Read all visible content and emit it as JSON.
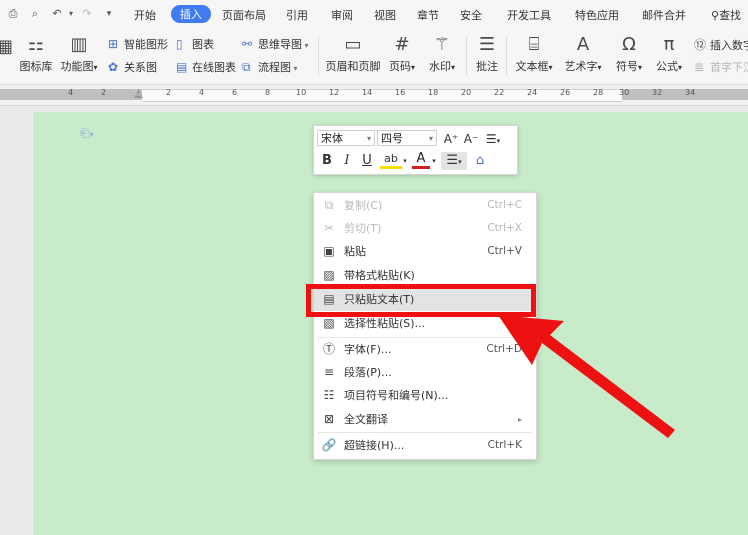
{
  "quick_access": [
    "print-icon",
    "preview-icon",
    "undo-icon",
    "undo-dropdown-icon",
    "redo-icon",
    "customize-icon"
  ],
  "tabs": [
    {
      "label": "开始",
      "active": false
    },
    {
      "label": "插入",
      "active": true
    },
    {
      "label": "页面布局",
      "active": false
    },
    {
      "label": "引用",
      "active": false
    },
    {
      "label": "审阅",
      "active": false
    },
    {
      "label": "视图",
      "active": false
    },
    {
      "label": "章节",
      "active": false
    },
    {
      "label": "安全",
      "active": false
    },
    {
      "label": "开发工具",
      "active": false
    },
    {
      "label": "特色应用",
      "active": false
    },
    {
      "label": "邮件合并",
      "active": false
    }
  ],
  "search_label": "查找",
  "ribbon": {
    "icon_library": "图标库",
    "function_chart": "功能图",
    "smart_shape": "智能图形",
    "chart": "图表",
    "mind_map": "思维导图",
    "relation_chart": "关系图",
    "online_chart": "在线图表",
    "flowchart": "流程图",
    "header_footer": "页眉和页脚",
    "page_number": "页码",
    "watermark": "水印",
    "comment": "批注",
    "textbox": "文本框",
    "wordart": "艺术字",
    "symbol": "符号",
    "formula": "公式",
    "insert_number": "插入数字",
    "drop_cap": "首字下沉"
  },
  "ruler": {
    "ticks": [
      "4",
      "2",
      "",
      "2",
      "4",
      "6",
      "8",
      "10",
      "12",
      "14",
      "16",
      "18",
      "20",
      "22",
      "24",
      "26",
      "28",
      "30",
      "32",
      "34"
    ]
  },
  "mini_toolbar": {
    "font": "宋体",
    "size": "四号",
    "bold": "B",
    "italic": "I",
    "underline": "U",
    "grow": "A⁺",
    "shrink": "A⁻"
  },
  "context_menu": [
    {
      "label": "复制(C)",
      "shortcut": "Ctrl+C",
      "icon": "copy-icon",
      "disabled": true
    },
    {
      "label": "剪切(T)",
      "shortcut": "Ctrl+X",
      "icon": "cut-icon",
      "disabled": true
    },
    {
      "label": "粘贴",
      "shortcut": "Ctrl+V",
      "icon": "paste-icon",
      "disabled": false
    },
    {
      "label": "带格式粘贴(K)",
      "shortcut": "",
      "icon": "paste-format-icon",
      "disabled": false
    },
    {
      "label": "只粘贴文本(T)",
      "shortcut": "",
      "icon": "paste-text-icon",
      "disabled": false,
      "highlighted": true
    },
    {
      "label": "选择性粘贴(S)...",
      "shortcut": "",
      "icon": "paste-special-icon",
      "disabled": false
    },
    {
      "label": "字体(F)...",
      "shortcut": "Ctrl+D",
      "icon": "font-icon",
      "disabled": false
    },
    {
      "label": "段落(P)...",
      "shortcut": "",
      "icon": "paragraph-icon",
      "disabled": false
    },
    {
      "label": "项目符号和编号(N)...",
      "shortcut": "",
      "icon": "bullets-icon",
      "disabled": false
    },
    {
      "label": "全文翻译",
      "shortcut": "▸",
      "icon": "translate-icon",
      "disabled": false
    },
    {
      "label": "超链接(H)...",
      "shortcut": "Ctrl+K",
      "icon": "link-icon",
      "disabled": false
    }
  ],
  "colors": {
    "accent": "#3f7cf2",
    "page": "#c8ecc9",
    "highlight_box": "#ee1111"
  }
}
